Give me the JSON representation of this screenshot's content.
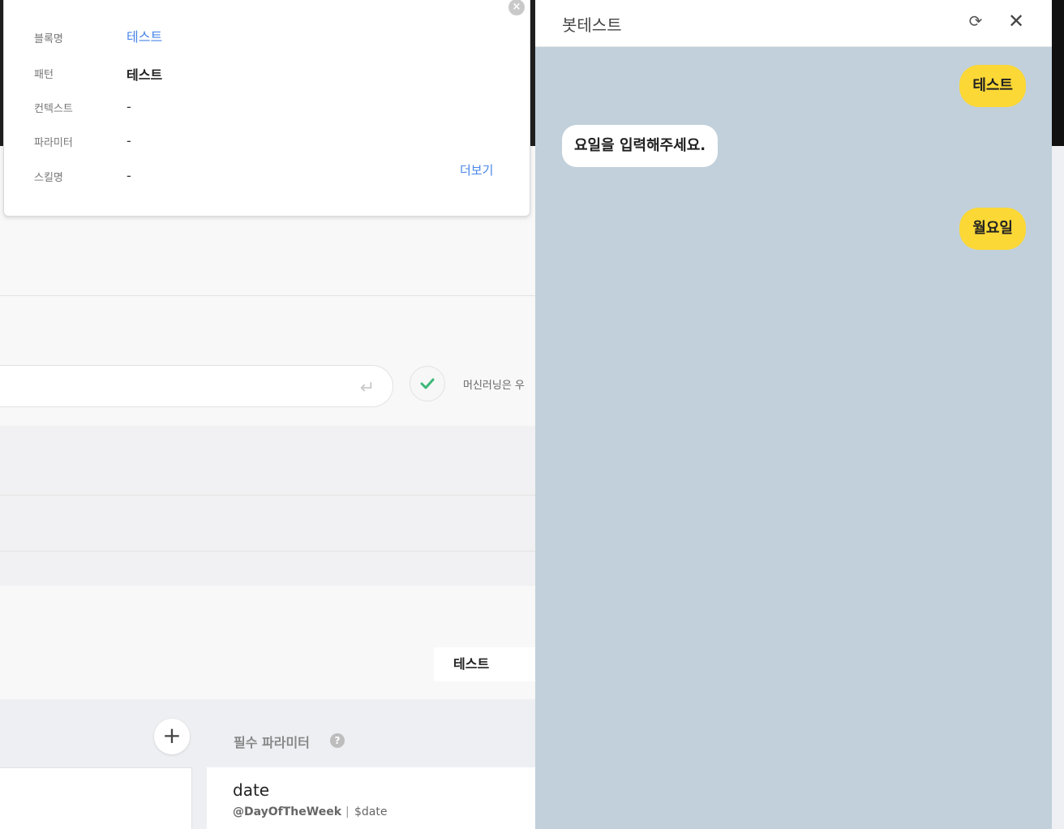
{
  "popup": {
    "close_label": "×",
    "rows": [
      {
        "label": "블록명",
        "value": "테스트"
      },
      {
        "label": "패턴",
        "value": "테스트"
      },
      {
        "label": "컨텍스트",
        "value": "-"
      },
      {
        "label": "파라미터",
        "value": "-"
      },
      {
        "label": "스킬명",
        "value": "-"
      }
    ],
    "more_link": "더보기"
  },
  "background": {
    "enter_icon": "↵",
    "ml_text": "머신러닝은 우",
    "response_chip": "테스트",
    "add_button": "+",
    "required_params_label": "필수 파라미터",
    "help_icon": "?",
    "param": {
      "name": "date",
      "entity": "@DayOfTheWeek",
      "separator": "|",
      "variable": "$date"
    }
  },
  "bot_test": {
    "title": "봇테스트",
    "refresh_icon": "⟳",
    "close_icon": "✕",
    "messages": [
      {
        "from": "user",
        "text": "테스트"
      },
      {
        "from": "bot",
        "text": "요일을 입력해주세요."
      },
      {
        "from": "user",
        "text": "월요일"
      }
    ]
  },
  "colors": {
    "user_bubble": "#fcd836",
    "chat_background": "#c1d0da",
    "link": "#4a86e8",
    "check": "#3cb878"
  }
}
